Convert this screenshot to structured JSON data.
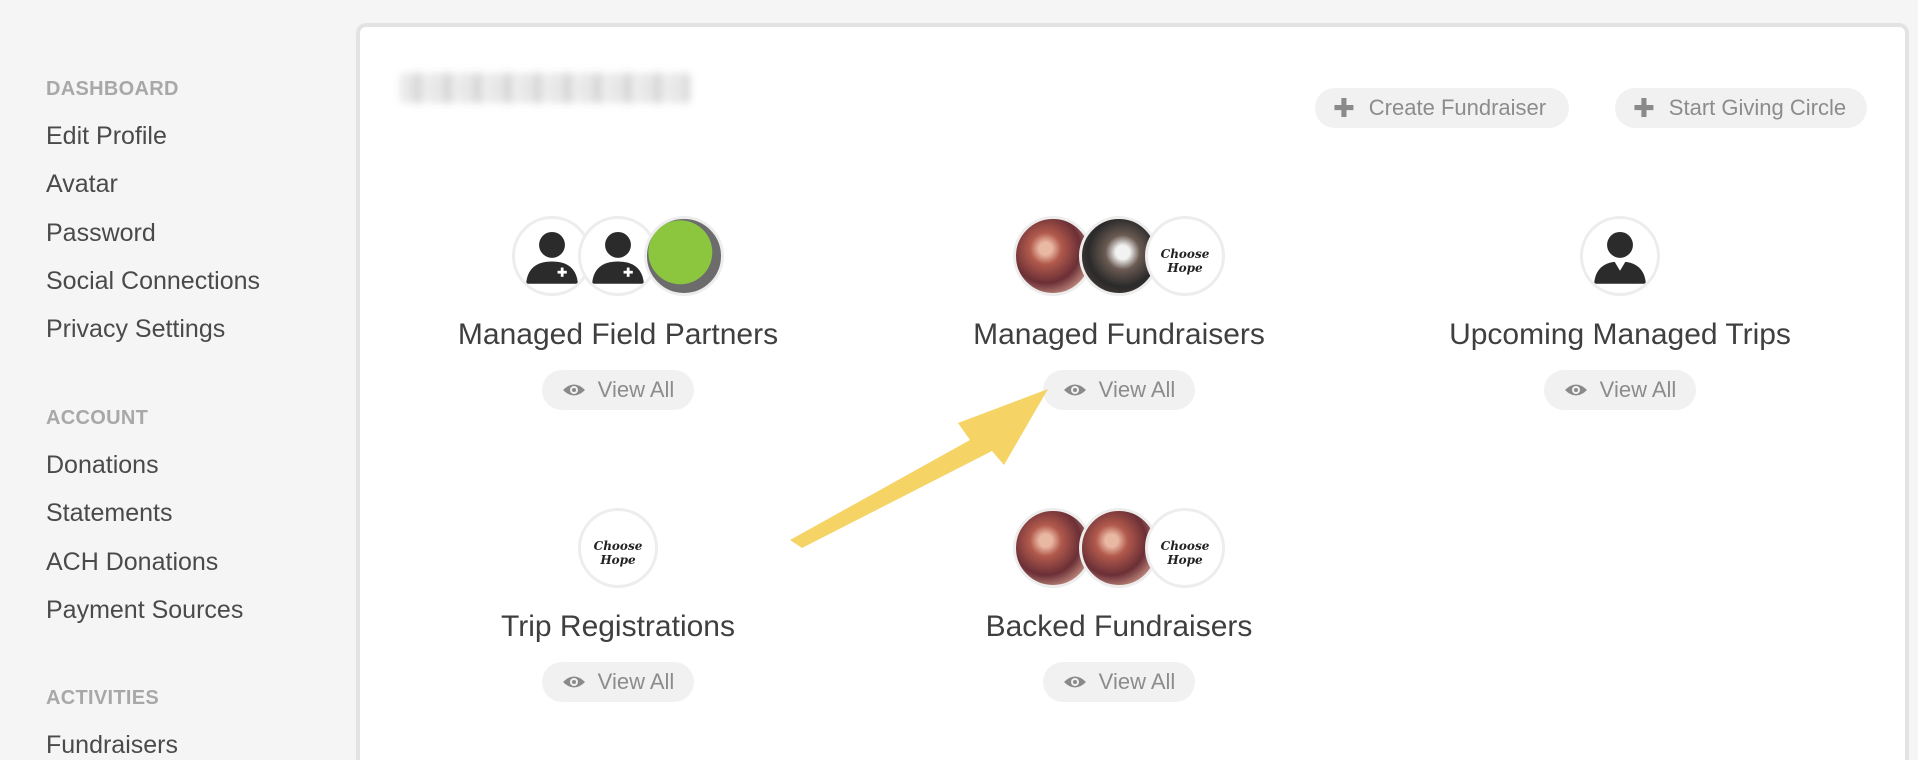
{
  "sidebar": {
    "sections": [
      {
        "heading": "DASHBOARD",
        "items": [
          "Edit Profile",
          "Avatar",
          "Password",
          "Social Connections",
          "Privacy Settings"
        ]
      },
      {
        "heading": "ACCOUNT",
        "items": [
          "Donations",
          "Statements",
          "ACH Donations",
          "Payment Sources"
        ]
      },
      {
        "heading": "ACTIVITIES",
        "items": [
          "Fundraisers"
        ]
      }
    ]
  },
  "header": {
    "create_fundraiser_label": "Create Fundraiser",
    "start_giving_circle_label": "Start Giving Circle",
    "icon": "plus-icon"
  },
  "cards": [
    {
      "title": "Managed Field Partners",
      "button": "View All"
    },
    {
      "title": "Managed Fundraisers",
      "button": "View All"
    },
    {
      "title": "Upcoming Managed Trips",
      "button": "View All"
    },
    {
      "title": "Trip Registrations",
      "button": "View All"
    },
    {
      "title": "Backed Fundraisers",
      "button": "View All"
    }
  ],
  "logo_text": "Choose Hope",
  "colors": {
    "annotation_arrow": "#f5d465",
    "button_bg": "#f1f1f1",
    "heading_gray": "#a8a8a8"
  }
}
